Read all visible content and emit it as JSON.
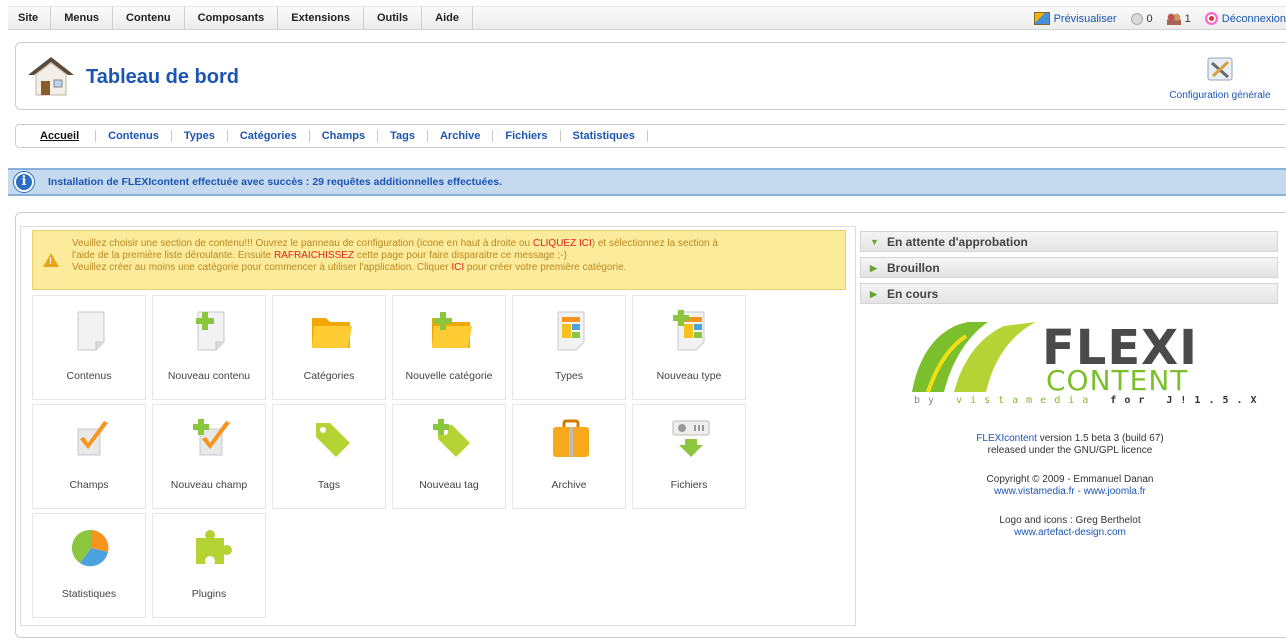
{
  "topmenu": {
    "items": [
      "Site",
      "Menus",
      "Contenu",
      "Composants",
      "Extensions",
      "Outils",
      "Aide"
    ],
    "preview": "Prévisualiser",
    "messages_count": "0",
    "users_count": "1",
    "logout": "Déconnexion"
  },
  "header": {
    "title": "Tableau de bord",
    "config_label": "Configuration générale"
  },
  "tabs": [
    "Accueil",
    "Contenus",
    "Types",
    "Catégories",
    "Champs",
    "Tags",
    "Archive",
    "Fichiers",
    "Statistiques"
  ],
  "info_message": "Installation de FLEXIcontent effectuée avec succès : 29 requêtes additionnelles effectuées.",
  "warning": {
    "l1a": "Veuillez choisir une section de contenu!!! Ouvrez le panneau de configuration (icone en haut à droite ou ",
    "l1b": "CLIQUEZ ICI",
    "l1c": ") et sélectionnez la section à",
    "l2a": "l'aide de la première liste déroulante. Ensuite ",
    "l2b": "RAFRAICHISSEZ",
    "l2c": " cette page pour faire disparaitre ce message ;-)",
    "l3a": "Veuillez créer au moins une catégorie pour commencer à utiliser l'application. Cliquer ",
    "l3b": "ICI",
    "l3c": " pour créer votre première catégorie."
  },
  "tiles": [
    {
      "label": "Contenus",
      "icon": "document-icon"
    },
    {
      "label": "Nouveau contenu",
      "icon": "new-document-icon"
    },
    {
      "label": "Catégories",
      "icon": "folder-icon"
    },
    {
      "label": "Nouvelle catégorie",
      "icon": "new-folder-icon"
    },
    {
      "label": "Types",
      "icon": "types-icon"
    },
    {
      "label": "Nouveau type",
      "icon": "new-type-icon"
    },
    {
      "label": "Champs",
      "icon": "checkmark-icon"
    },
    {
      "label": "Nouveau champ",
      "icon": "new-checkmark-icon"
    },
    {
      "label": "Tags",
      "icon": "tag-icon"
    },
    {
      "label": "Nouveau tag",
      "icon": "new-tag-icon"
    },
    {
      "label": "Archive",
      "icon": "archive-box-icon"
    },
    {
      "label": "Fichiers",
      "icon": "files-download-icon"
    },
    {
      "label": "Statistiques",
      "icon": "pie-chart-icon"
    },
    {
      "label": "Plugins",
      "icon": "puzzle-icon"
    }
  ],
  "panels": [
    "En attente d'approbation",
    "Brouillon",
    "En cours"
  ],
  "logo": {
    "word1": "FLEXI",
    "word2": "CONTENT",
    "tag_by": "by ",
    "tag_vista": "vistamedia",
    "tag_for": " for ",
    "tag_ver": "J!1.5.X"
  },
  "credits": {
    "product": "FLEXIcontent",
    "version_rest": " version 1.5 beta 3 (build 67)",
    "license": "released under the GNU/GPL licence",
    "copyright": "Copyright © 2009 - Emmanuel Danan",
    "link1": "www.vistamedia.fr",
    "sep": " - ",
    "link2": "www.joomla.fr",
    "logo_credit": "Logo and icons : Greg Berthelot",
    "link3": "www.artefact-design.com"
  }
}
